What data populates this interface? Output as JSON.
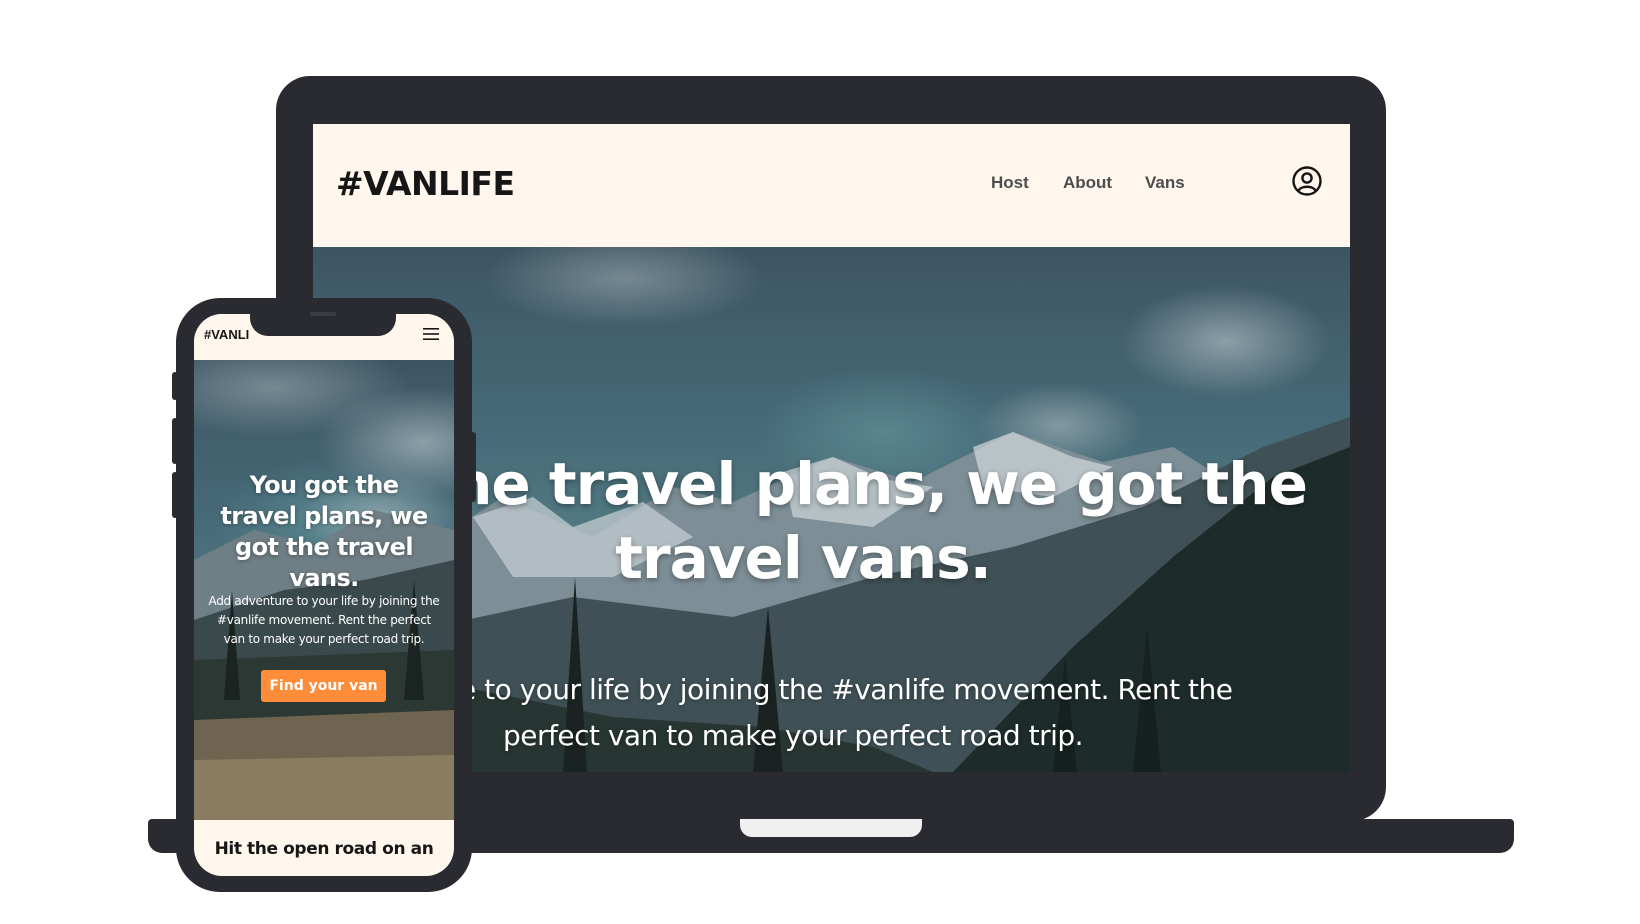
{
  "laptop": {
    "logo": "#VANLIFE",
    "nav": {
      "host": "Host",
      "about": "About",
      "vans": "Vans"
    },
    "hero": {
      "title_line1": "got the travel plans, we got the",
      "title_line2": "travel vans.",
      "subtitle_line1": "dventure to your life by joining the #vanlife movement. Rent the",
      "subtitle_line2": "perfect van to make your perfect road trip."
    }
  },
  "phone": {
    "logo": "#VANLI",
    "hero": {
      "title": "You got the travel plans, we got the travel vans.",
      "subtitle": "Add adventure to your life by joining the #vanlife movement. Rent the perfect van to make your perfect road trip.",
      "cta": "Find your van"
    },
    "next_section_heading": "Hit the open road on an"
  },
  "colors": {
    "device_frame": "#2a2b31",
    "page_background": "#fff7ed",
    "cta": "#ff8c38"
  },
  "icons": {
    "user": "user-circle-icon",
    "menu": "hamburger-menu-icon"
  }
}
